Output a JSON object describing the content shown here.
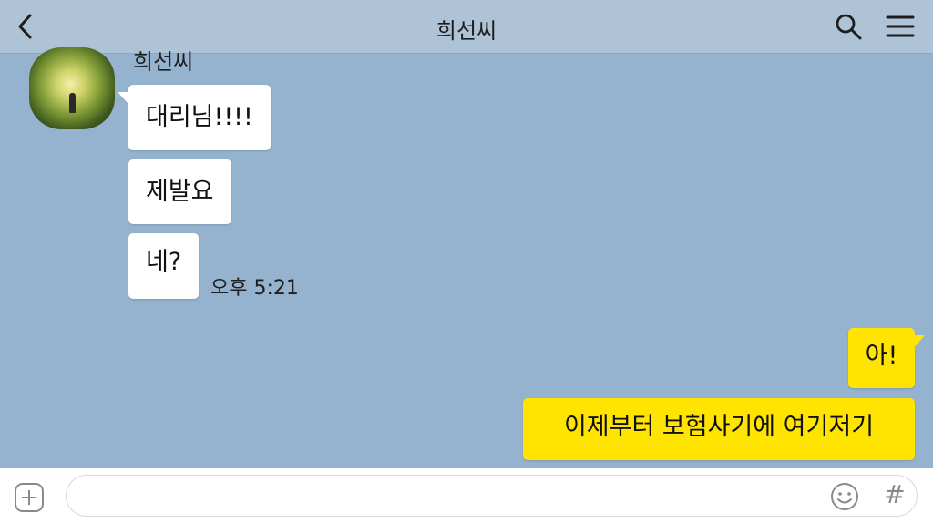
{
  "header": {
    "back_icon": "chevron-left-icon",
    "title": "희선씨",
    "search_icon": "search-icon",
    "menu_icon": "hamburger-menu-icon"
  },
  "chat": {
    "sender_name": "희선씨",
    "incoming": [
      {
        "text": "대리님!!!!"
      },
      {
        "text": "제발요"
      },
      {
        "text": "네?"
      }
    ],
    "incoming_time": "오후 5:21",
    "outgoing": [
      {
        "text": "아!"
      },
      {
        "text": "이제부터 보험사기에 여기저기"
      }
    ]
  },
  "input_bar": {
    "plus_icon": "plus-square-icon",
    "placeholder": "",
    "emoji_icon": "emoji-smile-icon",
    "hash_label": "#"
  },
  "colors": {
    "chat_background": "#95b3cf",
    "header_background": "#aec3d6",
    "incoming_bubble": "#ffffff",
    "outgoing_bubble": "#fee400"
  }
}
